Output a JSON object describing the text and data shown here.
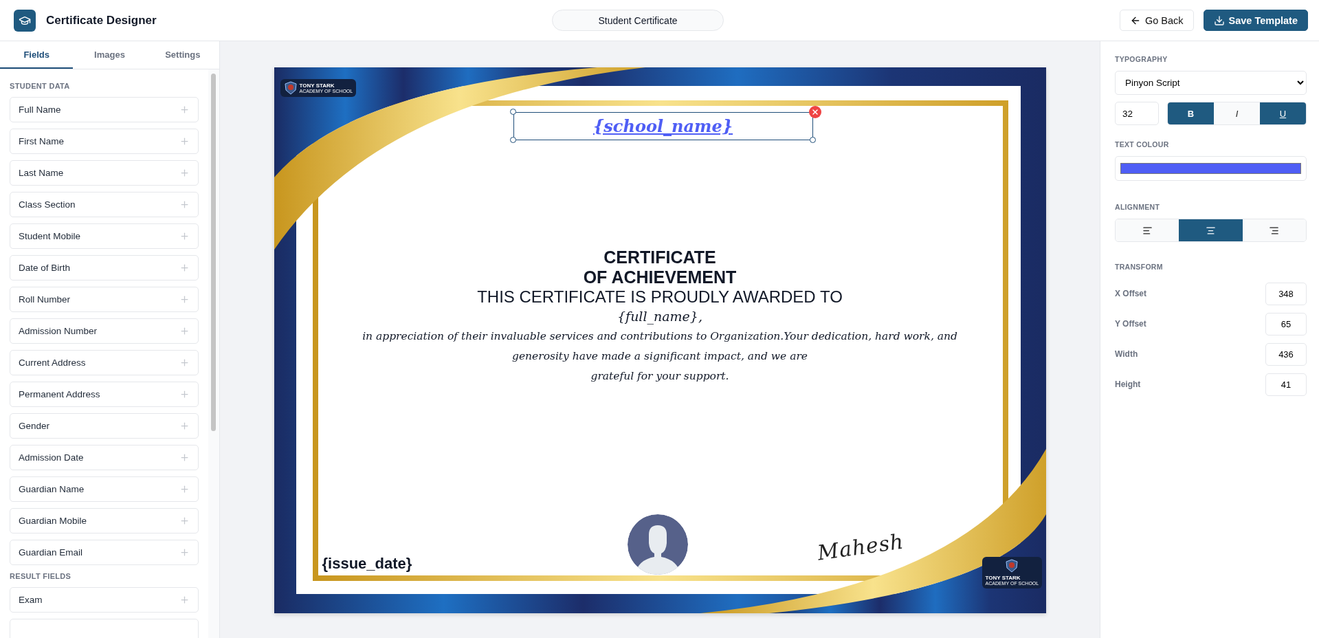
{
  "header": {
    "title": "Certificate Designer",
    "template_name": "Student Certificate",
    "buttons": [
      {
        "kind": "back",
        "label": "Go Back"
      },
      {
        "kind": "save",
        "label": "Save Template"
      }
    ]
  },
  "sidebar": {
    "tabs": [
      {
        "label": "Fields",
        "selected": true
      },
      {
        "label": "Images",
        "selected": false
      },
      {
        "label": "Settings",
        "selected": false
      }
    ],
    "sections": [
      {
        "title": "STUDENT DATA",
        "items": [
          "Full Name",
          "First Name",
          "Last Name",
          "Class Section",
          "Student Mobile",
          "Date of Birth",
          "Roll Number",
          "Admission Number",
          "Current Address",
          "Permanent Address",
          "Gender",
          "Admission Date",
          "Guardian Name",
          "Guardian Mobile",
          "Guardian Email"
        ]
      },
      {
        "title": "RESULT FIELDS",
        "items": [
          "Exam"
        ]
      }
    ]
  },
  "certificate": {
    "logo_top": {
      "name": "TONY STARK",
      "sub": "ACADEMY OF SCHOOL"
    },
    "selected_field": "{school_name}",
    "title_lines": [
      "CERTIFICATE",
      "OF ACHIEVEMENT"
    ],
    "subtitle": "THIS CERTIFICATE IS PROUDLY AWARDED TO",
    "recipient": "{full_name},",
    "body_lines": [
      "in appreciation of their invaluable services and contributions to Organization.Your dedication, hard work, and",
      "generosity have made a significant impact, and we are",
      "grateful for your support."
    ],
    "issue_date": "{issue_date}",
    "signature": "Mahesh",
    "logo_bottom": {
      "name": "TONY STARK",
      "sub": "ACADEMY OF SCHOOL"
    }
  },
  "properties": {
    "typography_label": "TYPOGRAPHY",
    "font": "Pinyon Script",
    "size": "32",
    "styles": [
      {
        "kind": "bold",
        "label": "B",
        "selected": true
      },
      {
        "kind": "italic",
        "label": "I",
        "selected": false
      },
      {
        "kind": "underline",
        "label": "U",
        "selected": true
      }
    ],
    "text_colour": {
      "label": "TEXT COLOUR",
      "color": "#4f5ef5"
    },
    "alignment_label": "ALIGNMENT",
    "alignment": [
      {
        "kind": "left",
        "selected": false
      },
      {
        "kind": "center",
        "selected": true
      },
      {
        "kind": "right",
        "selected": false
      }
    ],
    "transform_label": "TRANSFORM",
    "transform": [
      {
        "label": "X Offset",
        "value": "348"
      },
      {
        "label": "Y Offset",
        "value": "65"
      },
      {
        "label": "Width",
        "value": "436"
      },
      {
        "label": "Height",
        "value": "41"
      }
    ]
  }
}
